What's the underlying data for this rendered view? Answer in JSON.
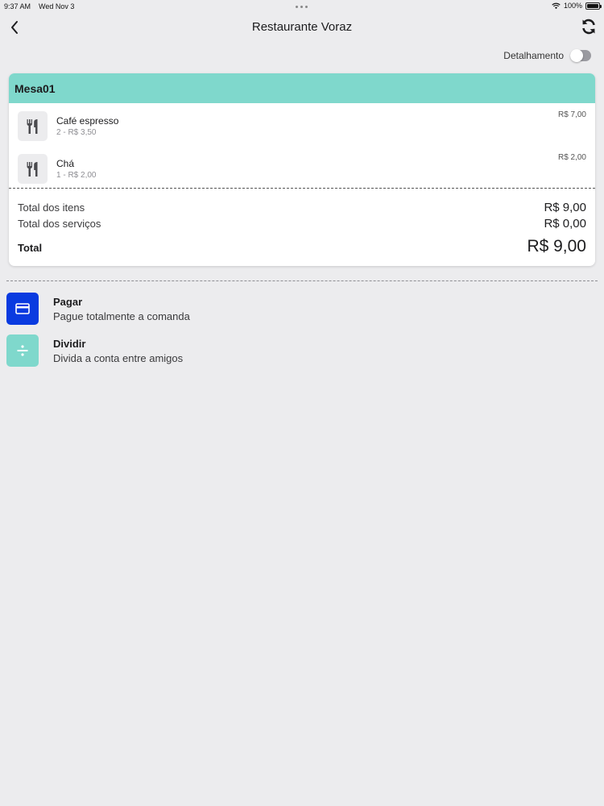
{
  "status_bar": {
    "time": "9:37 AM",
    "date": "Wed Nov 3",
    "battery": "100%",
    "battery_level": 1.0
  },
  "nav": {
    "title": "Restaurante Voraz",
    "back_icon": "chevron-left-icon",
    "refresh_icon": "refresh-icon"
  },
  "detail_toggle": {
    "label": "Detalhamento",
    "on": false
  },
  "order": {
    "table": "Mesa01",
    "header_color": "#7fd8cc",
    "items": [
      {
        "name": "Café espresso",
        "detail": "2 - R$ 3,50",
        "price": "R$ 7,00",
        "icon": "fork-knife-icon"
      },
      {
        "name": "Chá",
        "detail": "1 - R$ 2,00",
        "price": "R$ 2,00",
        "icon": "fork-knife-icon"
      }
    ],
    "totals": {
      "items_label": "Total dos itens",
      "items_value": "R$ 9,00",
      "services_label": "Total dos serviços",
      "services_value": "R$ 0,00",
      "total_label": "Total",
      "total_value": "R$ 9,00"
    }
  },
  "actions": [
    {
      "title": "Pagar",
      "subtitle": "Pague totalmente a comanda",
      "icon": "credit-card-icon",
      "color": "#0a3be0"
    },
    {
      "title": "Dividir",
      "subtitle": "Divida a conta entre amigos",
      "icon": "divide-icon",
      "color": "#7fd8cc"
    }
  ]
}
